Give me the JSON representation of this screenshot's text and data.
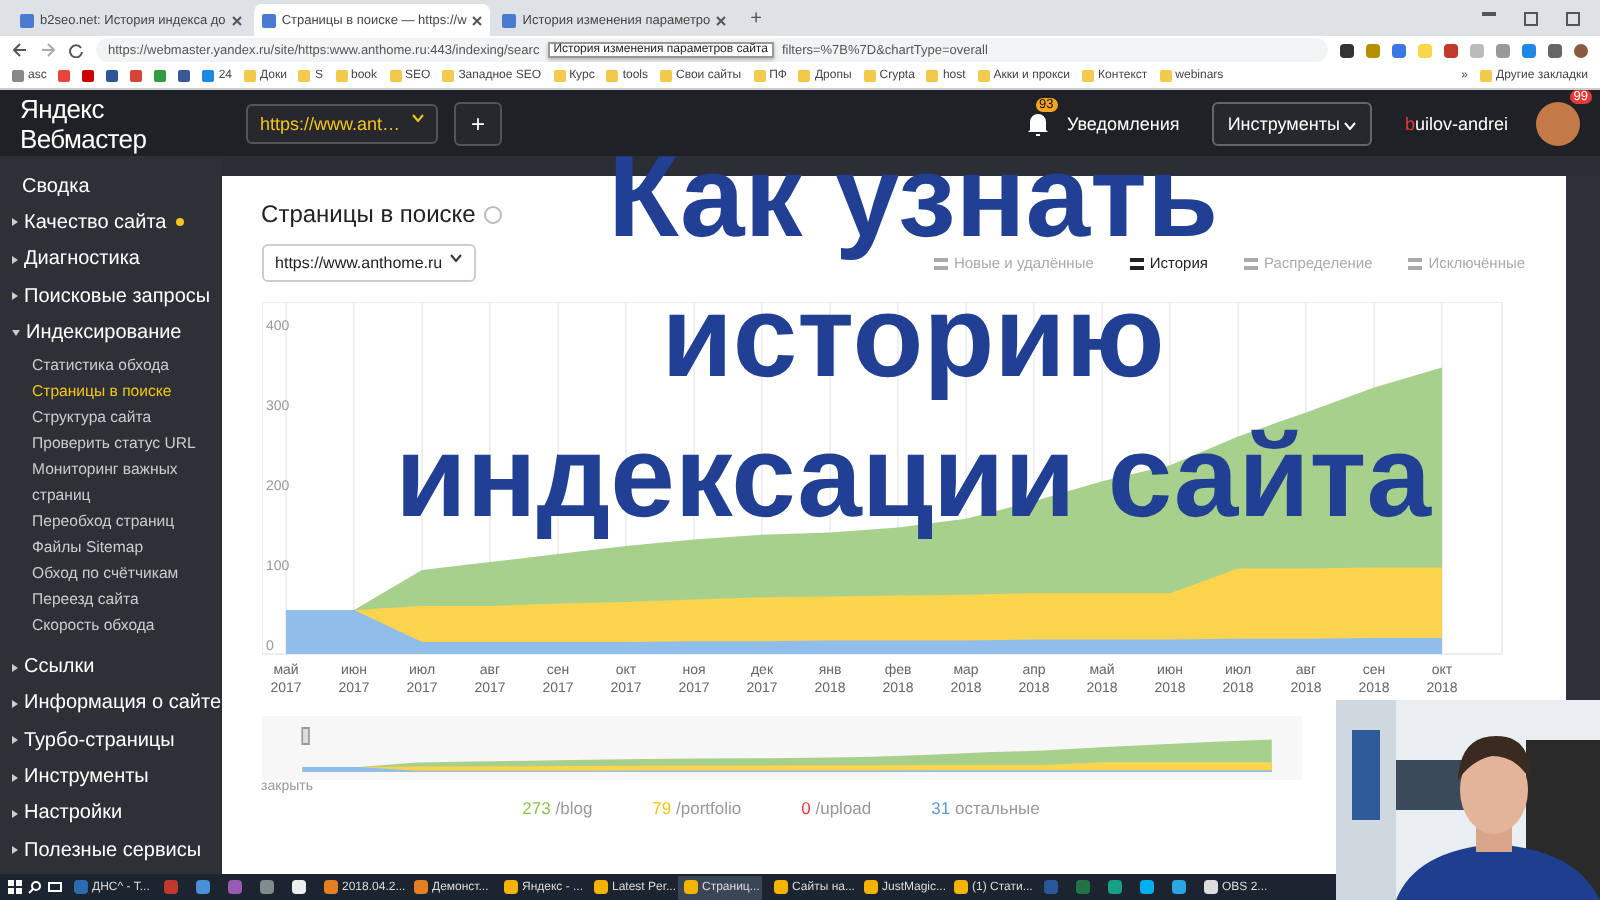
{
  "browser": {
    "tabs": [
      {
        "title": "b2seo.net: История индекса до",
        "selected": false
      },
      {
        "title": "Страницы в поиске — https://w",
        "selected": true
      },
      {
        "title": "История изменения параметро",
        "selected": false
      }
    ],
    "new_tab": "+",
    "address_before": "https://webmaster.yandex.ru/site/https:www.anthome.ru:443/indexing/searc",
    "tooltip": "История изменения параметров сайта",
    "address_after": "filters=%7B%7D&chartType=overall",
    "bookmarks": [
      {
        "kind": "site",
        "label": "asc",
        "color": "#888888"
      },
      {
        "kind": "icon",
        "color": "#e8453c"
      },
      {
        "kind": "icon",
        "color": "#cc0000"
      },
      {
        "kind": "icon",
        "color": "#2b5797"
      },
      {
        "kind": "icon",
        "color": "#d44638"
      },
      {
        "kind": "icon",
        "color": "#2e9e3e"
      },
      {
        "kind": "icon",
        "color": "#3b5998"
      },
      {
        "kind": "site",
        "label": "24",
        "color": "#1e88e5"
      },
      {
        "kind": "folder",
        "label": "Доки",
        "color": "#f2c94c"
      },
      {
        "kind": "folder",
        "label": "S",
        "color": "#f2c94c"
      },
      {
        "kind": "folder",
        "label": "book",
        "color": "#f2c94c"
      },
      {
        "kind": "folder",
        "label": "SEO",
        "color": "#f2c94c"
      },
      {
        "kind": "folder",
        "label": "Западное SEO",
        "color": "#f2c94c"
      },
      {
        "kind": "folder",
        "label": "Курс",
        "color": "#f2c94c"
      },
      {
        "kind": "folder",
        "label": "tools",
        "color": "#f2c94c"
      },
      {
        "kind": "folder",
        "label": "Свои сайты",
        "color": "#f2c94c"
      },
      {
        "kind": "folder",
        "label": "ПФ",
        "color": "#f2c94c"
      },
      {
        "kind": "folder",
        "label": "Дропы",
        "color": "#f2c94c"
      },
      {
        "kind": "folder",
        "label": "Crypta",
        "color": "#f2c94c"
      },
      {
        "kind": "folder",
        "label": "host",
        "color": "#f2c94c"
      },
      {
        "kind": "folder",
        "label": "Акки и прокси",
        "color": "#f2c94c"
      },
      {
        "kind": "folder",
        "label": "Контекст",
        "color": "#f2c94c"
      },
      {
        "kind": "folder",
        "label": "webinars",
        "color": "#f2c94c"
      }
    ],
    "more": "»",
    "other_bookmarks": "Другие закладки"
  },
  "header": {
    "logo": "Яндекс Вебмастер",
    "site_select": "https://www.ant…",
    "add_button": "+",
    "notifications_badge": "93",
    "notifications": "Уведомления",
    "tools": "Инструменты",
    "user": "builov-andrei",
    "avatar_badge": "99"
  },
  "sidebar": {
    "items": [
      {
        "kind": "link",
        "label": "Сводка"
      },
      {
        "kind": "section",
        "label": "Качество сайта",
        "expanded": false,
        "alert": true
      },
      {
        "kind": "section",
        "label": "Диагностика",
        "expanded": false,
        "alert": false
      },
      {
        "kind": "section",
        "label": "Поисковые запросы",
        "expanded": false,
        "alert": false
      },
      {
        "kind": "section",
        "label": "Индексирование",
        "expanded": true,
        "alert": false,
        "children": [
          {
            "label": "Статистика обхода",
            "selected": false
          },
          {
            "label": "Страницы в поиске",
            "selected": true
          },
          {
            "label": "Структура сайта",
            "selected": false
          },
          {
            "label": "Проверить статус URL",
            "selected": false
          },
          {
            "label": "Мониторинг важных страниц",
            "selected": false
          },
          {
            "label": "Переобход страниц",
            "selected": false
          },
          {
            "label": "Файлы Sitemap",
            "selected": false
          },
          {
            "label": "Обход по счётчикам",
            "selected": false
          },
          {
            "label": "Переезд сайта",
            "selected": false
          },
          {
            "label": "Скорость обхода",
            "selected": false
          }
        ]
      },
      {
        "kind": "section",
        "label": "Ссылки",
        "expanded": false,
        "alert": false
      },
      {
        "kind": "section",
        "label": "Информация о сайте",
        "expanded": false,
        "alert": false
      },
      {
        "kind": "section",
        "label": "Турбо-страницы",
        "expanded": false,
        "alert": false
      },
      {
        "kind": "section",
        "label": "Инструменты",
        "expanded": false,
        "alert": false
      },
      {
        "kind": "section",
        "label": "Настройки",
        "expanded": false,
        "alert": false
      },
      {
        "kind": "section",
        "label": "Полезные сервисы",
        "expanded": false,
        "alert": false
      }
    ]
  },
  "page": {
    "title": "Страницы в поиске",
    "site_select": "https://www.anthome.ru",
    "views": [
      {
        "label": "Новые и удалённые",
        "selected": false
      },
      {
        "label": "История",
        "selected": true
      },
      {
        "label": "Распределение",
        "selected": false
      },
      {
        "label": "Исключённые",
        "selected": false
      }
    ],
    "chart_data": {
      "type": "area",
      "categories": [
        "май 2017",
        "июн 2017",
        "июл 2017",
        "авг 2017",
        "сен 2017",
        "окт 2017",
        "ноя 2017",
        "дек 2017",
        "янв 2018",
        "фев 2018",
        "мар 2018",
        "апр 2018",
        "май 2018",
        "июн 2018",
        "июл 2018",
        "авг 2018",
        "сен 2018",
        "окт 2018"
      ],
      "series": [
        {
          "color": "#a7d08c",
          "values": [
            55,
            55,
            105,
            115,
            125,
            135,
            143,
            149,
            152,
            158,
            169,
            191,
            216,
            236,
            272,
            302,
            333,
            358
          ]
        },
        {
          "color": "#fdd44e",
          "values": [
            55,
            55,
            60,
            60,
            63,
            65,
            68,
            71,
            72,
            73,
            74,
            76,
            76,
            76,
            107,
            107,
            108,
            108
          ]
        },
        {
          "color": "#90bdea",
          "values": [
            55,
            55,
            15,
            15,
            15,
            15,
            16,
            16,
            17,
            17,
            17,
            18,
            18,
            18,
            19,
            19,
            20,
            20
          ]
        }
      ],
      "stacked": false,
      "grid": true,
      "yticks": [
        0,
        100,
        200,
        300,
        400
      ],
      "ylim": [
        0,
        440
      ]
    },
    "navigator_close": "закрыть",
    "legend": [
      {
        "value": "273",
        "label": "/blog",
        "color": "#8bc34a"
      },
      {
        "value": "79",
        "label": "/portfolio",
        "color": "#f5c518"
      },
      {
        "value": "0",
        "label": "/upload",
        "color": "#e53935"
      },
      {
        "value": "31",
        "label": "остальные",
        "color": "#5b9bd5"
      }
    ]
  },
  "overlay_title": [
    "Как узнать",
    "историю",
    "индексации сайта"
  ],
  "taskbar": {
    "items": [
      {
        "kind": "window",
        "label": "ДНС^ - Т...",
        "color": "#2b6cb0",
        "selected": false
      },
      {
        "kind": "icon",
        "color": "#c0392b",
        "selected": false
      },
      {
        "kind": "icon",
        "color": "#4a90d9",
        "selected": false
      },
      {
        "kind": "icon",
        "color": "#9b59b6",
        "selected": false
      },
      {
        "kind": "icon",
        "color": "#7f8c8d",
        "selected": false
      },
      {
        "kind": "icon",
        "color": "#ecf0f1",
        "selected": false
      },
      {
        "kind": "window",
        "label": "2018.04.2...",
        "color": "#e67e22",
        "selected": false
      },
      {
        "kind": "window",
        "label": "Демонст...",
        "color": "#e67e22",
        "selected": false
      },
      {
        "kind": "window",
        "label": "Яндекс - ...",
        "color": "#f4b400",
        "selected": false
      },
      {
        "kind": "window",
        "label": "Latest Per...",
        "color": "#f4b400",
        "selected": false
      },
      {
        "kind": "window",
        "label": "Страниц...",
        "color": "#f4b400",
        "selected": true
      },
      {
        "kind": "window",
        "label": "Сайты на...",
        "color": "#f4b400",
        "selected": false
      },
      {
        "kind": "window",
        "label": "JustMagic...",
        "color": "#f4b400",
        "selected": false
      },
      {
        "kind": "window",
        "label": "(1) Стати...",
        "color": "#f4b400",
        "selected": false
      },
      {
        "kind": "icon",
        "color": "#2b579a",
        "selected": false
      },
      {
        "kind": "icon",
        "color": "#217346",
        "selected": false
      },
      {
        "kind": "icon",
        "color": "#16a085",
        "selected": false
      },
      {
        "kind": "icon",
        "color": "#00aff0",
        "selected": false
      },
      {
        "kind": "icon",
        "color": "#2ca5e0",
        "selected": false
      },
      {
        "kind": "window",
        "label": "OBS 2...",
        "color": "#dddddd",
        "selected": false
      }
    ]
  },
  "webcam": {
    "kind": "picture"
  }
}
